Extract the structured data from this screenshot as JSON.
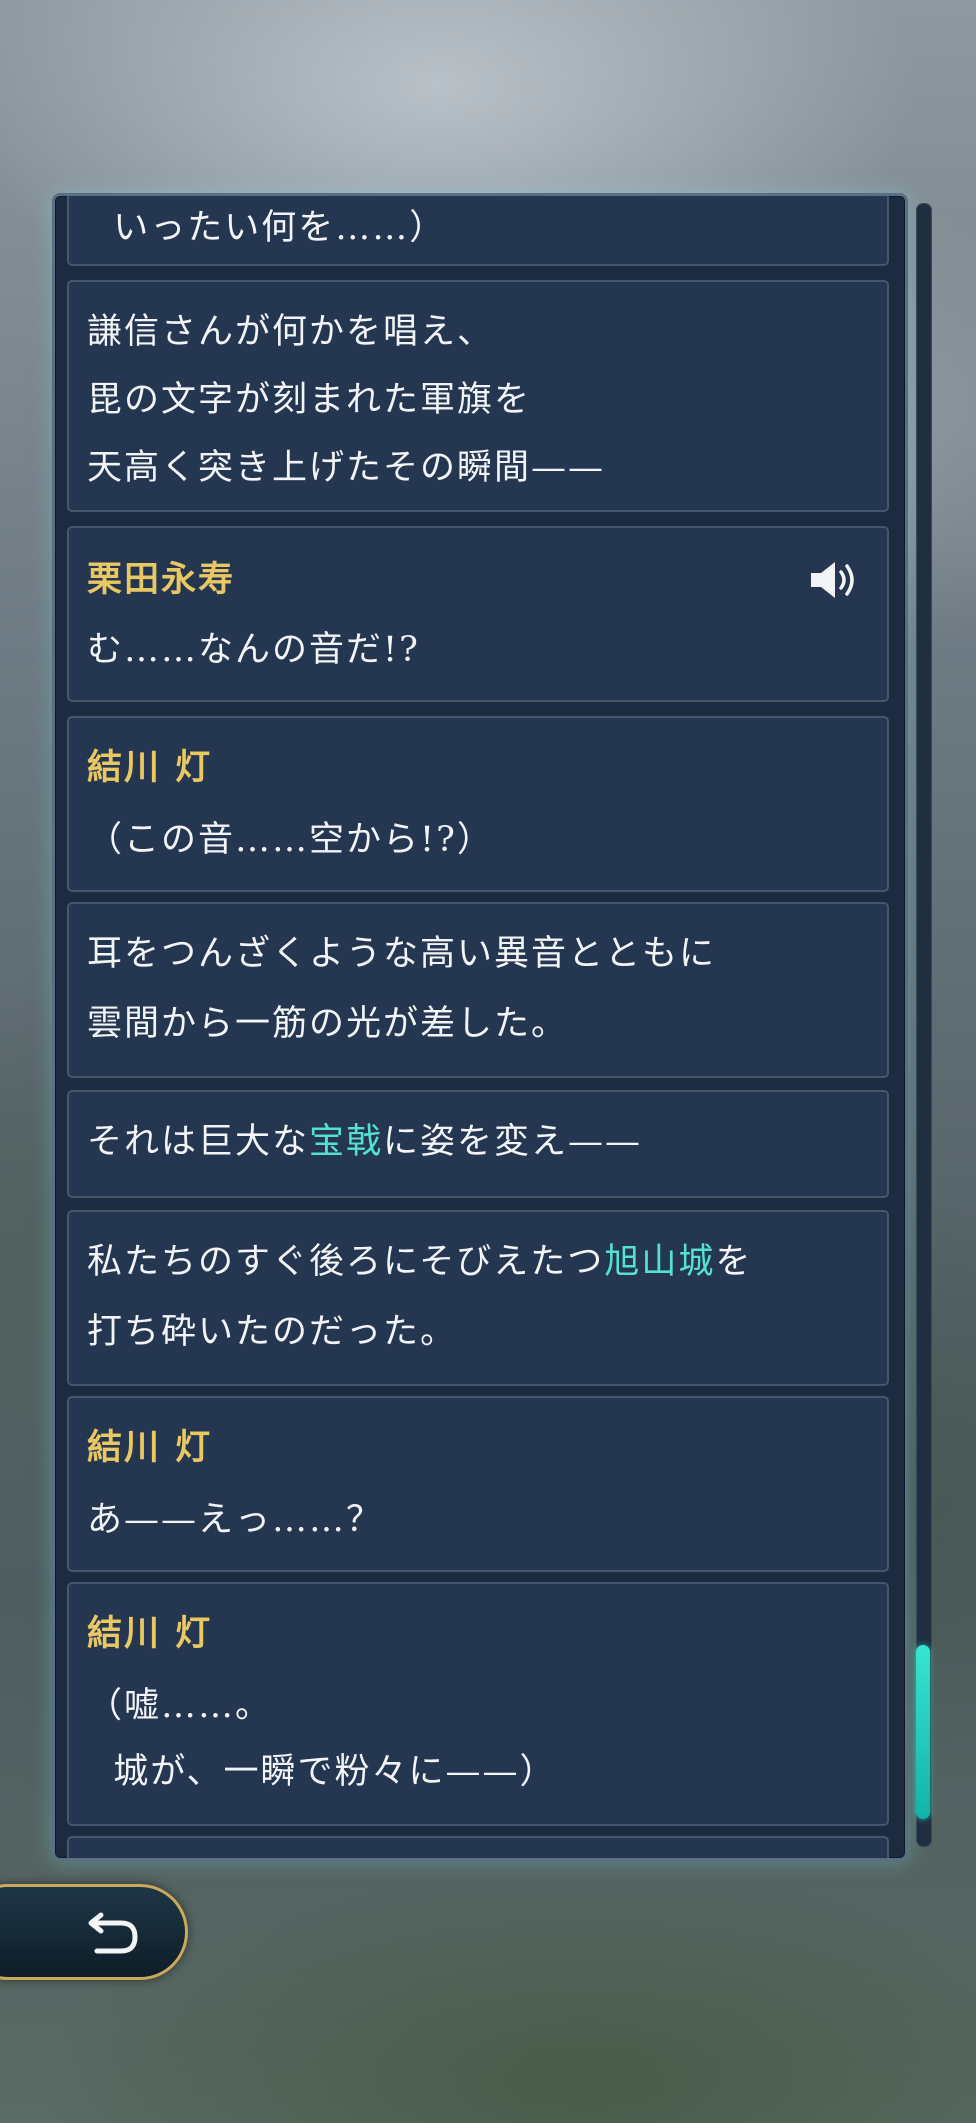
{
  "log": {
    "entries": [
      {
        "speaker": "",
        "segments": [
          [
            "  いったい何を……）"
          ]
        ],
        "voice": false
      },
      {
        "speaker": "",
        "segments": [
          [
            "謙信さんが何かを唱え、"
          ],
          [
            "毘の文字が刻まれた軍旗を"
          ],
          [
            "天高く突き上げたその瞬間——"
          ]
        ],
        "voice": false
      },
      {
        "speaker": "栗田永寿",
        "segments": [
          [
            "む……なんの音だ!?"
          ]
        ],
        "voice": true
      },
      {
        "speaker": "結川 灯",
        "segments": [
          [
            "（この音……空から!?）"
          ]
        ],
        "voice": false
      },
      {
        "speaker": "",
        "segments": [
          [
            "耳をつんざくような高い異音とともに"
          ],
          [
            "雲間から一筋の光が差した。"
          ]
        ],
        "voice": false
      },
      {
        "speaker": "",
        "segments": [
          [
            "それは巨大な",
            "宝戟",
            "に姿を変え——"
          ]
        ],
        "voice": false
      },
      {
        "speaker": "",
        "segments": [
          [
            "私たちのすぐ後ろにそびえたつ",
            "旭山城",
            "を"
          ],
          [
            "打ち砕いたのだった。"
          ]
        ],
        "voice": false
      },
      {
        "speaker": "結川 灯",
        "segments": [
          [
            "あ——えっ……？"
          ]
        ],
        "voice": false
      },
      {
        "speaker": "結川 灯",
        "segments": [
          [
            "（嘘……。"
          ],
          [
            "  城が、一瞬で粉々に——）"
          ]
        ],
        "voice": false
      }
    ]
  },
  "icons": {
    "voice": "speaker-volume-icon",
    "back": "return-arrow-icon"
  },
  "colors": {
    "speaker": "#e9c763",
    "highlight": "#54e0d3",
    "scroll_thumb": "#26d3c3",
    "button_border": "#c9a95b"
  },
  "scroll": {
    "position": 0.95
  }
}
